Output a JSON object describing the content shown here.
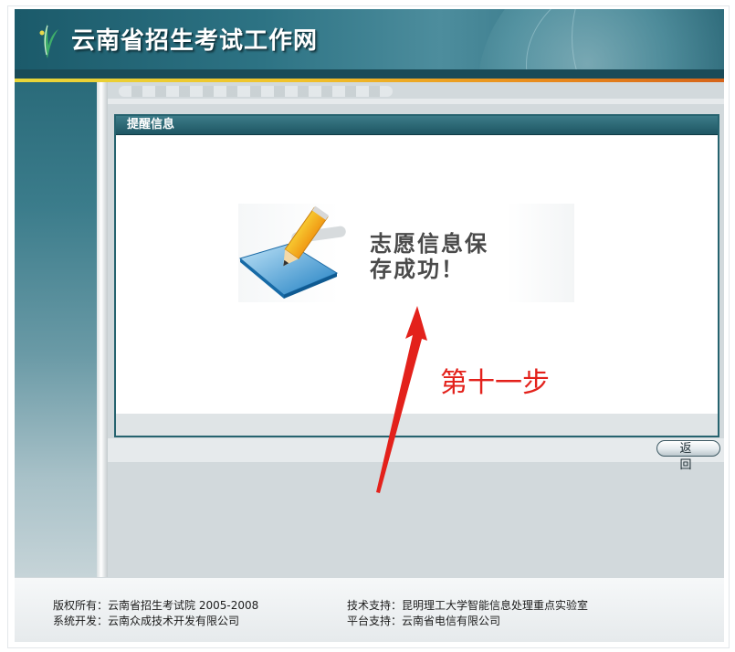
{
  "header": {
    "site_title": "云南省招生考试工作网"
  },
  "panel": {
    "title": "提醒信息",
    "message_line1": "志愿信息保",
    "message_line2": "存成功！"
  },
  "actions": {
    "back_label": "返回"
  },
  "annotation": {
    "text": "第十一步",
    "color": "#e3211b"
  },
  "footer": {
    "copyright_label": "版权所有：",
    "copyright_value": "云南省招生考试院 2005-2008",
    "dev_label": "系统开发：",
    "dev_value": "云南众成技术开发有限公司",
    "tech_label": "技术支持：",
    "tech_value": "昆明理工大学智能信息处理重点实验室",
    "platform_label": "平台支持：",
    "platform_value": "云南省电信有限公司"
  },
  "colors": {
    "header_teal": "#2d7384",
    "accent_stripe": "#f0c22b",
    "panel_border": "#26636f"
  }
}
